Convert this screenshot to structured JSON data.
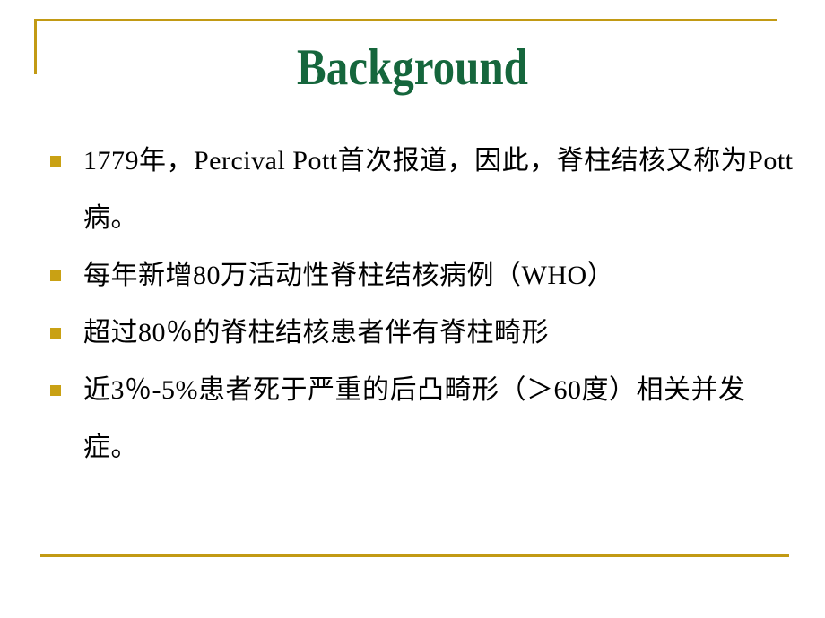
{
  "slide": {
    "title": "Background",
    "title_color": "#15663c",
    "accent_color": "#c29a14",
    "bullet_color": "#c9a114",
    "background_color": "#ffffff",
    "text_color": "#000000",
    "bullets": [
      {
        "text": "1779年，Percival Pott首次报道，因此，脊柱结核又称为Pott病。"
      },
      {
        "text": "每年新增80万活动性脊柱结核病例（WHO）"
      },
      {
        "text": "超过80％的脊柱结核患者伴有脊柱畸形"
      },
      {
        "text": "近3％-5%患者死于严重的后凸畸形（＞60度）相关并发症。"
      }
    ]
  }
}
